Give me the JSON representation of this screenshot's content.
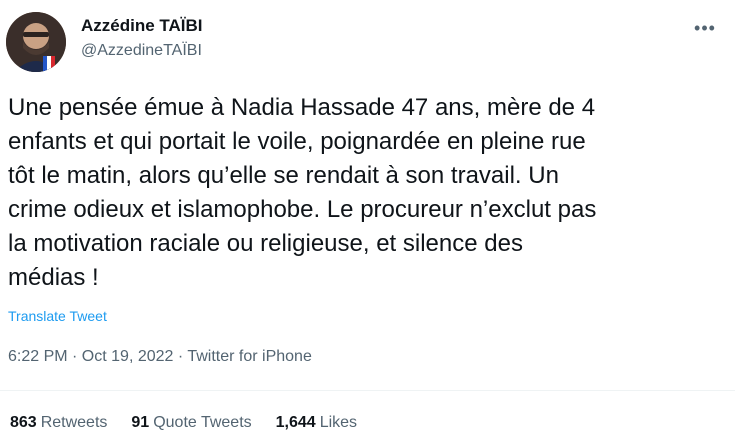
{
  "author": {
    "display_name": "Azzédine TAÏBI",
    "handle": "@AzzedineTAÏBI",
    "avatar_icon": "profile-photo"
  },
  "tweet": {
    "text": "Une pensée émue à Nadia Hassade 47 ans, mère de 4\nenfants et qui portait le voile, poignardée en pleine rue\ntôt le matin, alors qu’elle se rendait à son travail. Un\ncrime odieux et islamophobe. Le procureur n’exclut pas\nla motivation raciale ou religieuse, et silence des\nmédias !",
    "translate_label": "Translate Tweet",
    "timestamp": "6:22 PM · Oct 19, 2022 · Twitter for iPhone",
    "more_icon": "more-horizontal-icon"
  },
  "stats": {
    "retweets_count": "863",
    "retweets_label": "Retweets",
    "quotes_count": "91",
    "quotes_label": "Quote Tweets",
    "likes_count": "1,644",
    "likes_label": "Likes"
  },
  "colors": {
    "text": "#0f1419",
    "secondary": "#536471",
    "link": "#1d9bf0",
    "divider": "#eff3f4"
  }
}
